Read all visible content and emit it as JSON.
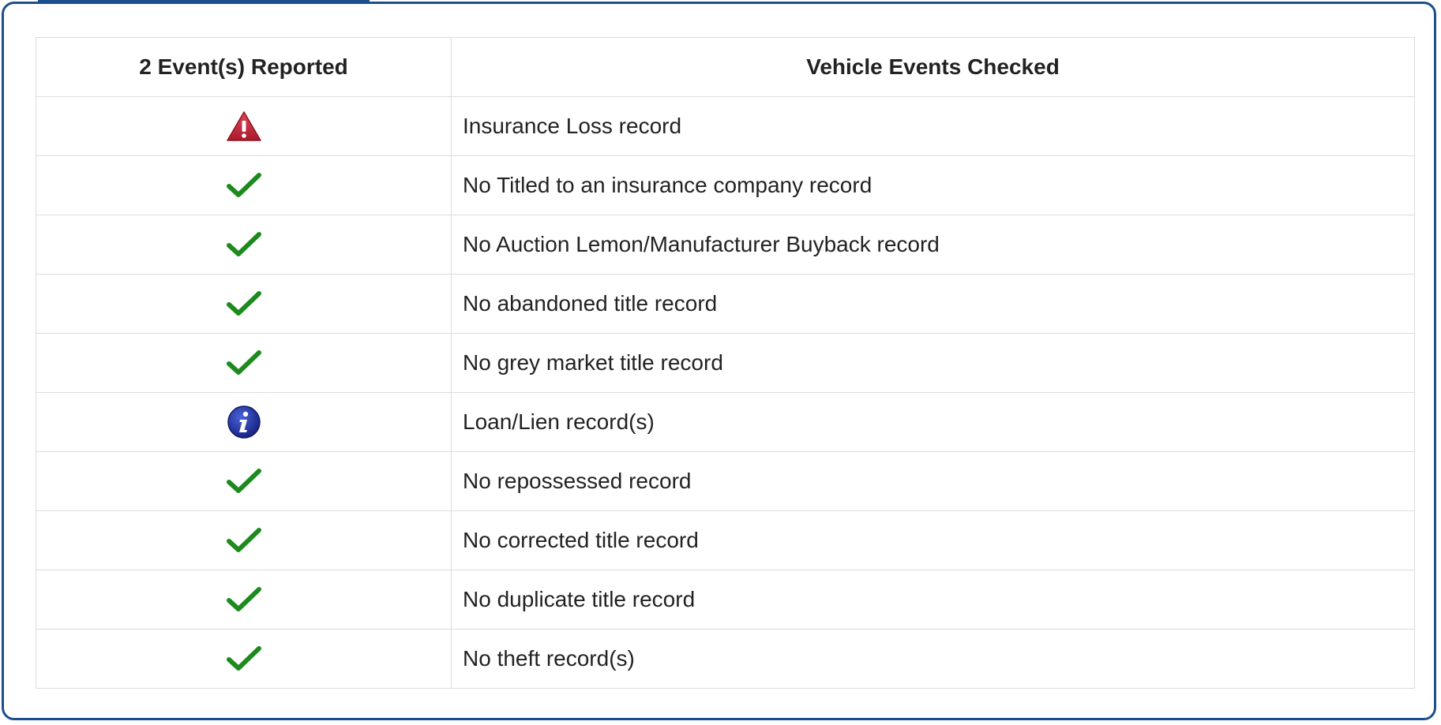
{
  "colors": {
    "frame": "#1a4f8b",
    "warning": "#c9283a",
    "check": "#1c8a1c",
    "info": "#1a2a9a"
  },
  "table": {
    "headers": {
      "status": "2 Event(s) Reported",
      "checked": "Vehicle Events Checked"
    },
    "rows": [
      {
        "icon": "warning-icon",
        "label": "Insurance Loss record"
      },
      {
        "icon": "checkmark-icon",
        "label": "No Titled to an insurance company record"
      },
      {
        "icon": "checkmark-icon",
        "label": "No Auction Lemon/Manufacturer Buyback record"
      },
      {
        "icon": "checkmark-icon",
        "label": "No abandoned title record"
      },
      {
        "icon": "checkmark-icon",
        "label": "No grey market title record"
      },
      {
        "icon": "info-icon",
        "label": "Loan/Lien record(s)"
      },
      {
        "icon": "checkmark-icon",
        "label": "No repossessed record"
      },
      {
        "icon": "checkmark-icon",
        "label": "No corrected title record"
      },
      {
        "icon": "checkmark-icon",
        "label": "No duplicate title record"
      },
      {
        "icon": "checkmark-icon",
        "label": "No theft record(s)"
      }
    ]
  }
}
